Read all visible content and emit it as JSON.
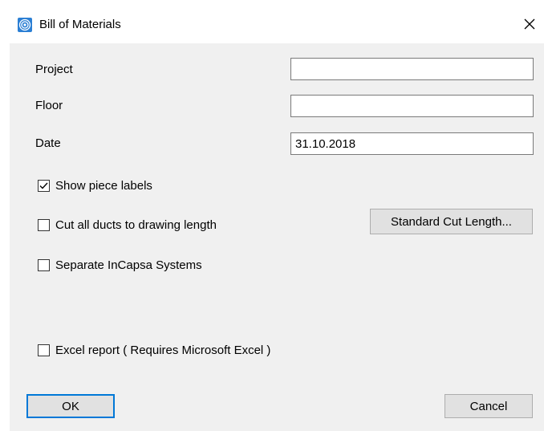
{
  "window": {
    "title": "Bill of Materials",
    "app_icon": "spiral-logo-icon",
    "close_icon": "close-icon"
  },
  "form": {
    "project": {
      "label": "Project",
      "value": ""
    },
    "floor": {
      "label": "Floor",
      "value": ""
    },
    "date": {
      "label": "Date",
      "value": "31.10.2018"
    }
  },
  "options": {
    "show_piece_labels": {
      "label": "Show piece labels",
      "checked": true
    },
    "cut_ducts": {
      "label": "Cut all ducts to drawing length",
      "checked": false
    },
    "separate_incapsa": {
      "label": "Separate InCapsa Systems",
      "checked": false
    },
    "excel_report": {
      "label": "Excel report ( Requires Microsoft Excel )",
      "checked": false
    }
  },
  "buttons": {
    "standard_cut_length": "Standard Cut Length...",
    "ok": "OK",
    "cancel": "Cancel"
  },
  "colors": {
    "dialog_bg": "#f0f0f0",
    "titlebar_bg": "#ffffff",
    "accent": "#0078d7",
    "icon_blue": "#2b7fd4"
  }
}
